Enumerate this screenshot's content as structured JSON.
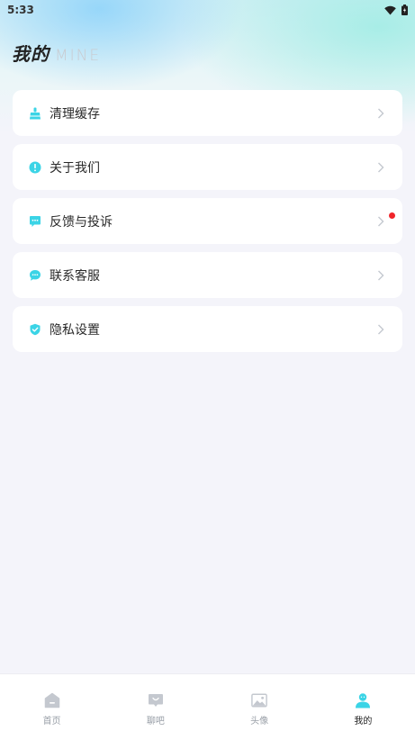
{
  "status_bar": {
    "time": "5:33"
  },
  "header": {
    "title": "我的",
    "subtitle": "MINE"
  },
  "menu": {
    "items": [
      {
        "label": "清理缓存",
        "icon": "broom-icon"
      },
      {
        "label": "关于我们",
        "icon": "info-icon"
      },
      {
        "label": "反馈与投诉",
        "icon": "feedback-icon",
        "badge": "red-dot"
      },
      {
        "label": "联系客服",
        "icon": "chat-icon"
      },
      {
        "label": "隐私设置",
        "icon": "shield-icon"
      }
    ]
  },
  "tabbar": {
    "items": [
      {
        "label": "首页",
        "icon": "home-icon"
      },
      {
        "label": "聊吧",
        "icon": "chat-bubble-icon"
      },
      {
        "label": "头像",
        "icon": "image-icon"
      },
      {
        "label": "我的",
        "icon": "user-icon",
        "active": true
      }
    ]
  },
  "colors": {
    "accent": "#3bd4e6",
    "inactive": "#c4c8cf",
    "badge": "#f0242a"
  }
}
